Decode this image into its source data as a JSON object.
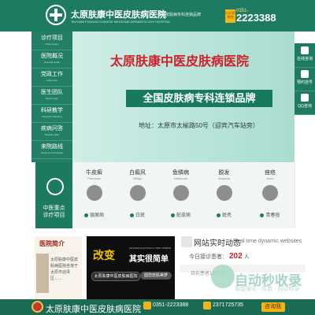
{
  "header": {
    "site_name": "太原肤康中医皮肤病医院",
    "site_name_en": "TAIYUAN FUKANG CHINESE MEDICINE DERMATOLOGY HOSPITAL",
    "slogan": "全国皮肤病专科连锁品牌",
    "hotline_badge": "24小时热线",
    "phone_prefix": "0351-",
    "phone_number": "2223388"
  },
  "nav": [
    {
      "cn": "诊疗项目",
      "en": "Clinic project"
    },
    {
      "cn": "医院概况",
      "en": "Hospital profile"
    },
    {
      "cn": "党政工作",
      "en": "Party work"
    },
    {
      "cn": "医生团队",
      "en": "Doctor team"
    },
    {
      "cn": "科研教学",
      "en": "Research teaching"
    },
    {
      "cn": "疾病问答",
      "en": "Disease Q&A"
    },
    {
      "cn": "来院路线",
      "en": "Route to the hospital"
    }
  ],
  "banner": {
    "title": "太原肤康中医皮肤病医院",
    "tagline": "全国皮肤病专科连锁品牌",
    "address": "地址：太原市太榆路50号（迎宾汽车站旁）"
  },
  "right_bar": [
    {
      "label": "在线咨询"
    },
    {
      "label": "预约挂号"
    },
    {
      "label": "QQ咨询"
    }
  ],
  "focus": {
    "label_line1": "中医重点",
    "label_line2": "诊疗项目"
  },
  "specialties": [
    {
      "name": "牛皮癣",
      "en": "Psoriasis",
      "link": "银屑病"
    },
    {
      "name": "白癜风",
      "en": "Vitiligo",
      "link": "白斑"
    },
    {
      "name": "鱼鳞病",
      "en": "Ichthyosis",
      "link": "蛇皮病"
    },
    {
      "name": "脱发",
      "en": "Alopecia",
      "link": "斑秃"
    },
    {
      "name": "痤疮",
      "en": "Acne",
      "link": "青春痘"
    }
  ],
  "intro": {
    "title": "医院简介",
    "text": "太原肤康中医皮肤病医院坐落于太原市迎泽区……"
  },
  "promo": {
    "title": "改变",
    "subtitle": "其实很简单",
    "subtitle_en": "CHANGE IS ACTUALLY VERY SIMPLE",
    "pill_left": "太原肤康中医皮肤病医院",
    "pill_right": "圆您皮肤美梦"
  },
  "stats": {
    "title": "网站实时动态",
    "title_en": "Real-time dynamic websites",
    "today_label": "今日接诊患者",
    "today_count": "202",
    "today_unit": "人",
    "ticker": "目前患者1月诊疗…"
  },
  "watermark": {
    "brand": "自动秒收录",
    "sub": "智能搜索 · 免费  ·  自动收录"
  },
  "footer": {
    "name": "太原肤康中医皮肤病医院",
    "phone": "0351-2223388",
    "qq": "2371725735",
    "consult": "咨询我"
  }
}
